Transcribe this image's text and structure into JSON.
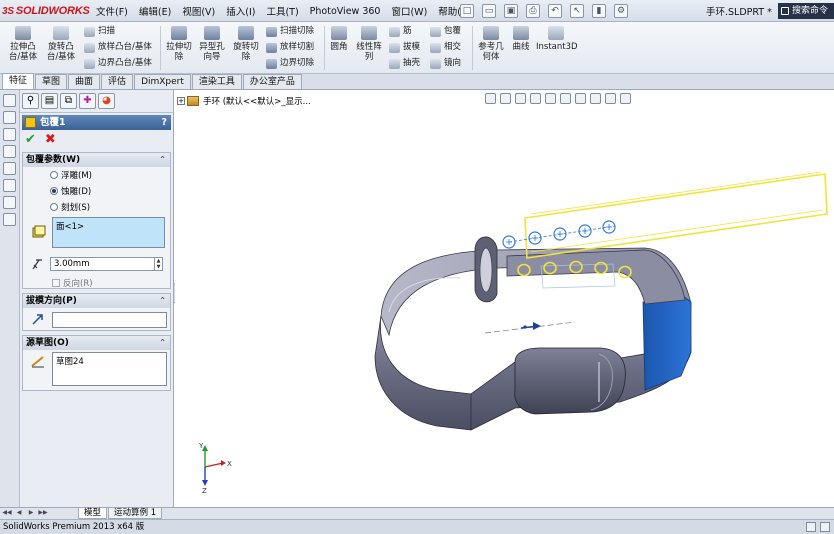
{
  "app": {
    "logo_ds": "3S",
    "logo_text": "SOLIDWORKS",
    "document_title": "手环.SLDPRT *",
    "search_label": "搜索命令"
  },
  "menu": [
    "文件(F)",
    "编辑(E)",
    "视图(V)",
    "插入(I)",
    "工具(T)",
    "PhotoView 360",
    "窗口(W)",
    "帮助(H)"
  ],
  "quick_access_icons": [
    "new-icon",
    "open-icon",
    "save-icon",
    "print-icon",
    "undo-icon",
    "select-icon",
    "rebuild-icon",
    "options-icon"
  ],
  "ribbon": {
    "extrude_boss": "拉伸凸\n台/基体",
    "revolve_boss": "旋转凸\n台/基体",
    "sweep": "扫描",
    "loft_boss": "放样凸台/基体",
    "boundary_boss": "边界凸台/基体",
    "extrude_cut": "拉伸切\n除",
    "hole_wizard": "异型孔\n向导",
    "revolve_cut": "旋转切\n除",
    "swept_cut": "扫描切除",
    "lofted_cut": "放样切割",
    "boundary_cut": "边界切除",
    "fillet": "圆角",
    "linear_pattern": "线性阵\n列",
    "rib": "筋",
    "draft": "拔模",
    "shell": "抽壳",
    "wrap": "包覆",
    "intersect": "相交",
    "mirror": "镜向",
    "reference_geometry": "参考几\n何体",
    "curves": "曲线",
    "instant3d": "Instant3D"
  },
  "tabs": [
    "特征",
    "草图",
    "曲面",
    "评估",
    "DimXpert",
    "渲染工具",
    "办公室产品"
  ],
  "active_tab": "特征",
  "property_manager": {
    "title": "包覆1",
    "help": "?",
    "wrap_params": {
      "header": "包覆参数(W)",
      "options": [
        "浮雕(M)",
        "蚀雕(D)",
        "刻划(S)"
      ],
      "selected": "蚀雕(D)",
      "face_selection": "面<1>",
      "depth_value": "3.00mm",
      "reverse_label": "反向(R)"
    },
    "pull_direction": {
      "header": "拔模方向(P)"
    },
    "source_sketch": {
      "header": "源草图(O)",
      "value": "草图24"
    }
  },
  "feature_tree": {
    "item": "手环  (默认<<默认>_显示..."
  },
  "bottom_tabs": [
    "模型",
    "运动算例 1"
  ],
  "active_bottom_tab": "模型",
  "status_bar": "SolidWorks Premium 2013 x64 版",
  "triad": {
    "x": "X",
    "y": "Y",
    "z": "Z"
  },
  "colors": {
    "brand_red": "#c8161d",
    "selection_yellow": "#f2e33a",
    "edge_blue": "#2f7be0",
    "band_body": "#6d6f86",
    "band_face_blue": "#1f5fb8"
  }
}
